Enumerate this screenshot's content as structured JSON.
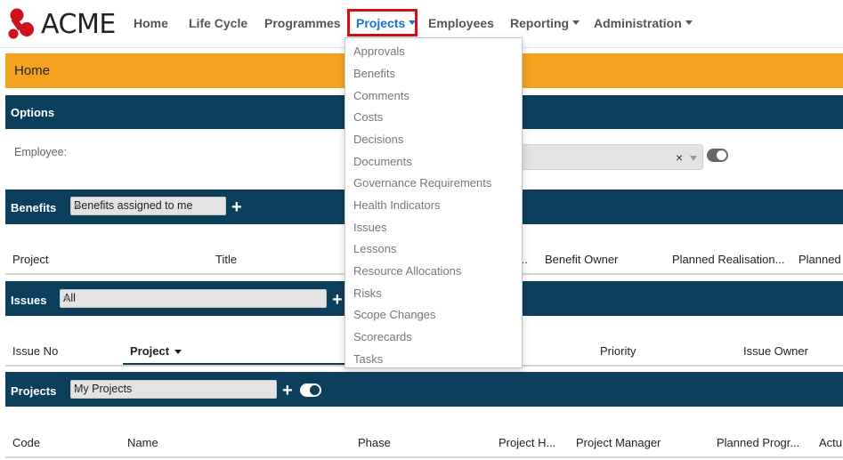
{
  "brand": {
    "name": "ACME",
    "accent": "#d0101a"
  },
  "nav": {
    "home": "Home",
    "life_cycle": "Life Cycle",
    "programmes": "Programmes",
    "projects": "Projects",
    "employees": "Employees",
    "reporting": "Reporting",
    "administration": "Administration"
  },
  "projects_menu": {
    "items": [
      "Approvals",
      "Benefits",
      "Comments",
      "Costs",
      "Decisions",
      "Documents",
      "Governance Requirements",
      "Health Indicators",
      "Issues",
      "Lessons",
      "Resource Allocations",
      "Risks",
      "Scope Changes",
      "Scorecards",
      "Tasks"
    ]
  },
  "home_bar": {
    "title": "Home",
    "color": "#f4a21f"
  },
  "options": {
    "title": "Options",
    "employee_label": "Employee:",
    "clear_symbol": "×"
  },
  "benefits": {
    "title": "Benefits",
    "filter": "Benefits assigned to me",
    "add": "+",
    "columns": [
      "Project",
      "Title",
      "...",
      "Benefit Owner",
      "Planned Realisation...",
      "Planned"
    ]
  },
  "issues": {
    "title": "Issues",
    "filter": "All",
    "add": "+",
    "columns": [
      "Issue No",
      "Project",
      "Priority",
      "Issue Owner"
    ]
  },
  "projects": {
    "title": "Projects",
    "filter": "My Projects",
    "add": "+",
    "columns": [
      "Code",
      "Name",
      "Phase",
      "Project H...",
      "Project Manager",
      "Planned Progr...",
      "Actu"
    ]
  },
  "colors": {
    "dark_bar": "#0b3f5b",
    "link": "#1a73c8"
  }
}
